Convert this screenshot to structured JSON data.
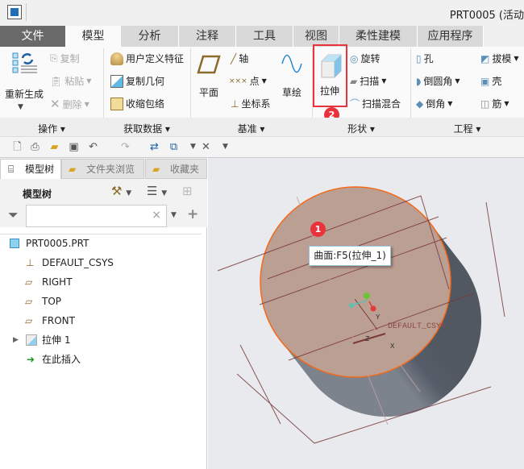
{
  "title": "PRT0005 (活动",
  "tabs": [
    {
      "label": "文件"
    },
    {
      "label": "模型"
    },
    {
      "label": "分析"
    },
    {
      "label": "注释"
    },
    {
      "label": "工具"
    },
    {
      "label": "视图"
    },
    {
      "label": "柔性建模"
    },
    {
      "label": "应用程序"
    }
  ],
  "ribbon": {
    "regenerate": "重新生成",
    "copy": "复制",
    "paste": "粘贴",
    "delete": "删除",
    "udf": "用户定义特征",
    "copy_geom": "复制几何",
    "shrinkwrap": "收缩包络",
    "plane": "平面",
    "axis": "轴",
    "point": "点",
    "csys": "坐标系",
    "sketch": "草绘",
    "extrude": "拉伸",
    "revolve": "旋转",
    "sweep": "扫描",
    "swept_blend": "扫描混合",
    "hole": "孔",
    "round": "倒圆角",
    "chamfer": "倒角",
    "draft": "拔模",
    "shell": "壳",
    "rib": "筋",
    "groups": {
      "operations": "操作",
      "get_data": "获取数据",
      "datum": "基准",
      "shapes": "形状",
      "engineering": "工程"
    },
    "highlight_color": "#e8323c"
  },
  "panel": {
    "tabs": {
      "model_tree": "模型树",
      "folder_browser": "文件夹浏览器",
      "favorites": "收藏夹"
    },
    "header": "模型树",
    "search_value": "",
    "clear_icon": "×",
    "tree": [
      {
        "label": "PRT0005.PRT",
        "icon": "part-icon"
      },
      {
        "label": "DEFAULT_CSYS",
        "icon": "csys-icon"
      },
      {
        "label": "RIGHT",
        "icon": "datum-plane-icon"
      },
      {
        "label": "TOP",
        "icon": "datum-plane-icon"
      },
      {
        "label": "FRONT",
        "icon": "datum-plane-icon"
      },
      {
        "label": "拉伸 1",
        "icon": "extrude-icon"
      },
      {
        "label": "在此插入",
        "icon": "insert-here-icon"
      }
    ]
  },
  "viewport": {
    "tooltip": "曲面:F5(拉伸_1)",
    "csys_label": "DEFAULT_CSYS",
    "axis_x": "X",
    "axis_y": "Y",
    "axis_z": "Z"
  },
  "badges": {
    "one": "1",
    "two": "2"
  }
}
